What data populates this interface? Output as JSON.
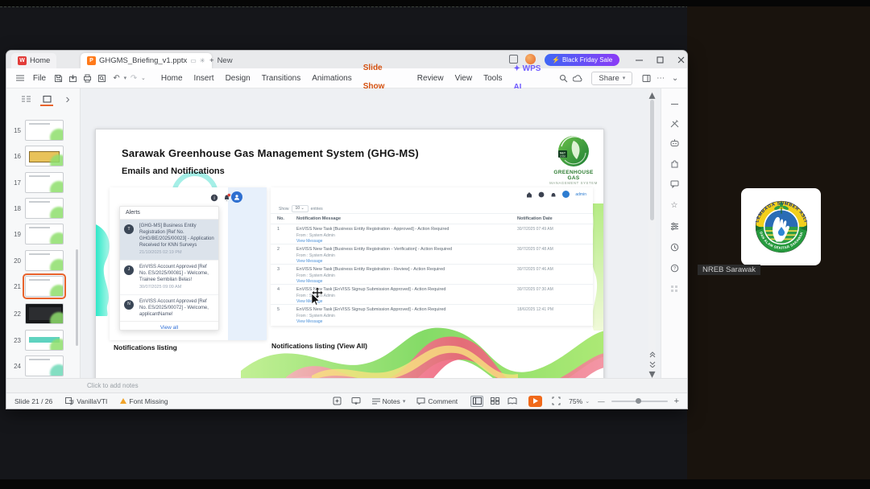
{
  "chrome": {
    "home_tab": "Home",
    "doc_tab": "GHGMS_Briefing_v1.pptx",
    "new_tab": "New",
    "sale_button": "Black Friday Sale",
    "file_menu": "File",
    "menus": [
      "Home",
      "Insert",
      "Design",
      "Transitions",
      "Animations",
      "Slide Show",
      "Review",
      "View",
      "Tools"
    ],
    "wps_ai": "WPS AI",
    "share_button": "Share",
    "accent_orange": "#e8632c"
  },
  "slide_panel": {
    "slides": [
      "15",
      "16",
      "17",
      "18",
      "19",
      "20",
      "21",
      "22",
      "23",
      "24"
    ],
    "selected": "21"
  },
  "slide": {
    "title": "Sarawak Greenhouse Gas Management System (GHG-MS)",
    "subtitle": "Emails and Notifications",
    "logo": {
      "badge_line1": "NET",
      "badge_line2": "2050",
      "name_line1": "GREENHOUSE GAS",
      "name_line2": "MANAGEMENT SYSTEM"
    },
    "left_caption": "Notifications listing",
    "right_caption": "Notifications listing (View All)",
    "alerts": {
      "title": "Alerts",
      "view_all": "View all",
      "items": [
        {
          "initial": "T",
          "text": "[GHG-MS] Business Entity Registration [Ref No. GHG/BE/2025/00023] - Application Received for KNN Surveys",
          "time": "21/10/2025 02:19 PM"
        },
        {
          "initial": "J",
          "text": "EnVISS Account Approved [Ref No. ES/2025/00081] - Welcome, Trainee Sembilan Belas!",
          "time": "30/07/2025 09:09 AM"
        },
        {
          "initial": "N",
          "text": "EnVISS Account Approved [Ref No. ES/2025/00072] - Welcome, applicantName!",
          "time": ""
        }
      ]
    },
    "portal": {
      "admin_label": "admin",
      "show_label": "Show",
      "show_value": "10",
      "entries_label": "entries",
      "headers": [
        "No.",
        "Notification Message",
        "Notification Date"
      ],
      "rows": [
        {
          "no": "1",
          "message": "EnVISS New Task [Business Entity Registration - Approved] - Action Required",
          "from": "From : System Admin",
          "link": "View Message",
          "date": "30/7/2025 07:49 AM"
        },
        {
          "no": "2",
          "message": "EnVISS New Task [Business Entity Registration - Verification] - Action Required",
          "from": "From : System Admin",
          "link": "View Message",
          "date": "30/7/2025 07:48 AM"
        },
        {
          "no": "3",
          "message": "EnVISS New Task [Business Entity Registration - Review] - Action Required",
          "from": "From : System Admin",
          "link": "View Message",
          "date": "30/7/2025 07:46 AM"
        },
        {
          "no": "4",
          "message": "EnVISS New Task [EnVISS Signup Submission Approved] - Action Required",
          "from": "From : System Admin",
          "link": "View Message",
          "date": "30/7/2025 07:30 AM"
        },
        {
          "no": "5",
          "message": "EnVISS New Task [EnVISS Signup Submission Approved] - Action Required",
          "from": "From : System Admin",
          "link": "View Message",
          "date": "18/6/2025 12:41 PM"
        }
      ]
    }
  },
  "notes_bar": {
    "placeholder": "Click to add notes"
  },
  "status": {
    "slide_counter": "Slide 21 / 26",
    "theme_name": "VanillaVTI",
    "font_missing": "Font Missing",
    "notes_label": "Notes",
    "comment_label": "Comment",
    "zoom_level": "75%"
  },
  "meeting": {
    "participant": "NREB Sarawak",
    "logo_arc_top": "LEMBAGA SUMBER ASLI",
    "logo_arc_bottom": "DAN ALAM SEKITAR SARAWAK"
  }
}
